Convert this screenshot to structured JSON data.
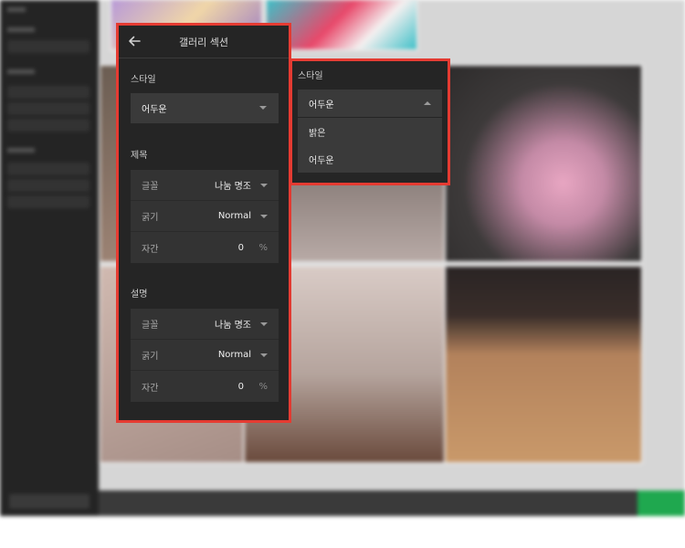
{
  "panel": {
    "title": "갤러리 섹션",
    "style_section": {
      "label": "스타일",
      "value": "어두운"
    },
    "title_section": {
      "label": "제목",
      "font_label": "글꼴",
      "font_value": "나눔 명조",
      "weight_label": "굵기",
      "weight_value": "Normal",
      "spacing_label": "자간",
      "spacing_value": "0",
      "spacing_unit": "%"
    },
    "desc_section": {
      "label": "설명",
      "font_label": "글꼴",
      "font_value": "나눔 명조",
      "weight_label": "굵기",
      "weight_value": "Normal",
      "spacing_label": "자간",
      "spacing_value": "0",
      "spacing_unit": "%"
    }
  },
  "style_dropdown": {
    "label": "스타일",
    "selected": "어두운",
    "options": [
      "밝은",
      "어두운"
    ]
  },
  "colors": {
    "highlight": "#e53b32",
    "panel_bg": "#252525",
    "field_bg": "#3a3a3a",
    "accent_green": "#1fa84f"
  }
}
